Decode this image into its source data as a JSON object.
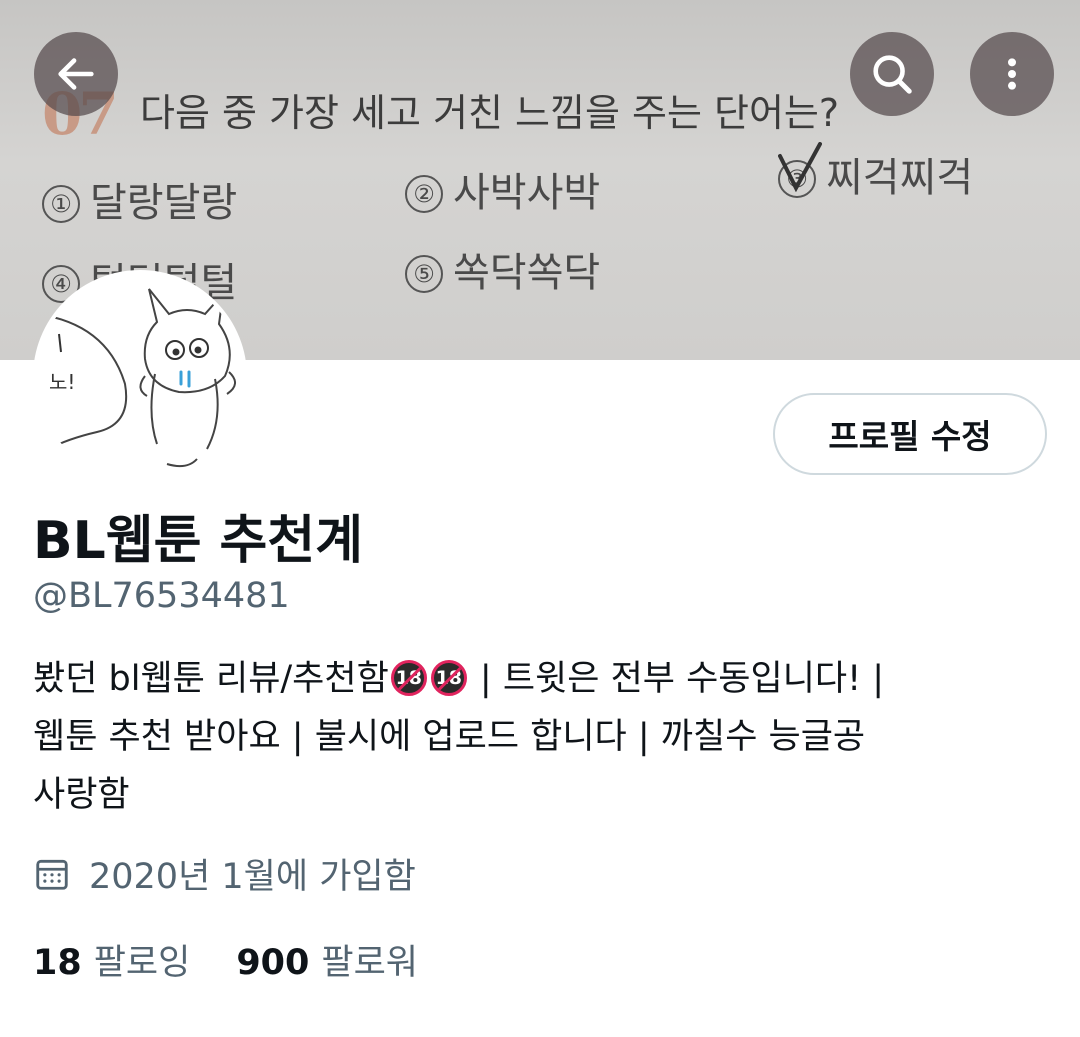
{
  "banner": {
    "question_number": "07",
    "question": "다음 중 가장 세고 거친 느낌을 주는 단어는?",
    "options": [
      {
        "mark": "①",
        "text": "달랑달랑"
      },
      {
        "mark": "②",
        "text": "사박사박"
      },
      {
        "mark": "③",
        "text": "찌걱찌걱"
      },
      {
        "mark": "④",
        "text": "털털털털"
      },
      {
        "mark": "⑤",
        "text": "쏙닥쏙닥"
      }
    ]
  },
  "controls": {
    "back_icon": "arrow-left-icon",
    "search_icon": "search-icon",
    "more_icon": "more-vertical-icon"
  },
  "avatar": {
    "scribble_text": "노!"
  },
  "edit_profile_label": "프로필 수정",
  "profile": {
    "display_name": "BL웹툰 추천계",
    "handle": "@BL76534481",
    "bio_part1": "봤던 bl웹툰 리뷰/추천함",
    "bio_emoji": "18",
    "bio_part2": " | 트윗은 전부 수동입니다! |",
    "bio_line2": "웹툰 추천 받아요 | 불시에 업로드 합니다 | 까칠수 능글공",
    "bio_line3": "사랑함",
    "joined": "2020년 1월에 가입함",
    "following_count": "18",
    "following_label": "팔로잉",
    "followers_count": "900",
    "followers_label": "팔로워"
  },
  "colors": {
    "text": "#0f1419",
    "secondary": "#536471",
    "border": "#cfd9de"
  }
}
